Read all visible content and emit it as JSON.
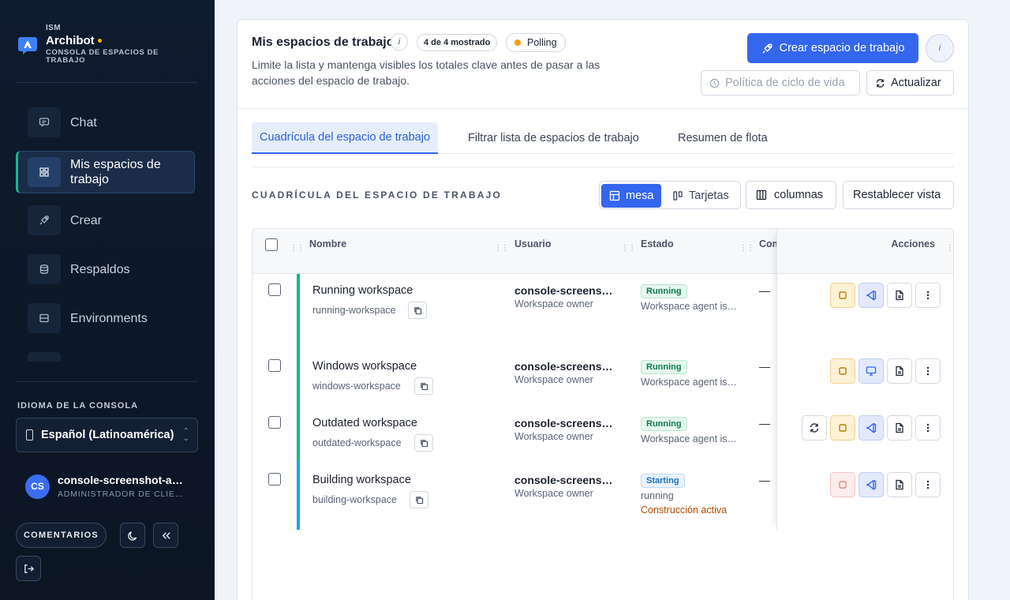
{
  "brand": {
    "small": "ISM",
    "name": "Archibot",
    "subtitle": "CONSOLA DE ESPACIOS DE TRABAJO"
  },
  "sidebar": {
    "items": [
      {
        "label": "Chat",
        "icon": "chat-icon"
      },
      {
        "label": "Mis espacios de trabajo",
        "icon": "grid-icon",
        "active": true
      },
      {
        "label": "Crear",
        "icon": "rocket-icon"
      },
      {
        "label": "Respaldos",
        "icon": "database-icon"
      },
      {
        "label": "Environments",
        "icon": "server-icon"
      }
    ],
    "language_title": "IDIOMA DE LA CONSOLA",
    "language_value": "Español (Latinoamérica)",
    "user": {
      "initials": "CS",
      "name": "console-screenshot-admin",
      "role": "ADMINISTRADOR DE CLIENTE"
    },
    "feedback_label": "COMENTARIOS"
  },
  "header": {
    "title": "Mis espacios de trabajo",
    "info_glyph": "i",
    "count_pill": "4 de 4 mostrado",
    "polling_label": "Polling",
    "description": "Limite la lista y mantenga visibles los totales clave antes de pasar a las acciones del espacio de trabajo.",
    "create_label": "Crear espacio de trabajo",
    "lifecycle_label": "Política de ciclo de vida",
    "refresh_label": "Actualizar"
  },
  "tabs": [
    {
      "label": "Cuadrícula del espacio de trabajo",
      "active": true
    },
    {
      "label": "Filtrar lista de espacios de trabajo"
    },
    {
      "label": "Resumen de flota"
    }
  ],
  "grid": {
    "section_title": "CUADRÍCULA DEL ESPACIO DE TRABAJO",
    "view_table": "mesa",
    "view_cards": "Tarjetas",
    "columns_label": "columnas",
    "reset_label": "Restablecer vista",
    "columns": {
      "name": "Nombre",
      "user": "Usuario",
      "status": "Estado",
      "comp": "Com",
      "actions": "Acciones"
    },
    "rows": [
      {
        "name": "Running workspace",
        "slug": "running-workspace",
        "user": "console-screenshot-admin",
        "user_role": "Workspace owner",
        "status": "Running",
        "status_detail": "Workspace agent is connected",
        "status_extra": "",
        "comp": "—",
        "bar_color": "#19b888"
      },
      {
        "name": "Windows workspace",
        "slug": "windows-workspace",
        "user": "console-screenshot-admin",
        "user_role": "Workspace owner",
        "status": "Running",
        "status_detail": "Workspace agent is connected",
        "status_extra": "",
        "comp": "—",
        "bar_color": "#19b888"
      },
      {
        "name": "Outdated workspace",
        "slug": "outdated-workspace",
        "user": "console-screenshot-admin",
        "user_role": "Workspace owner",
        "status": "Running",
        "status_detail": "Workspace agent is connected",
        "status_extra": "",
        "comp": "—",
        "bar_color": "#19b888"
      },
      {
        "name": "Building workspace",
        "slug": "building-workspace",
        "user": "console-screenshot-admin",
        "user_role": "Workspace owner",
        "status": "Starting",
        "status_detail": "running",
        "status_extra": "Construcción activa",
        "comp": "—",
        "bar_color": "#1fa3e6"
      }
    ]
  },
  "colors": {
    "primary": "#3466ee",
    "sidebar_bg": "#0f1b2e",
    "running": "#137a4f",
    "starting": "#1f6fb5",
    "polling": "#f59e0b"
  }
}
